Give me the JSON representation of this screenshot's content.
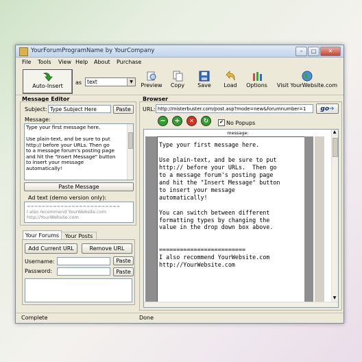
{
  "window": {
    "title": "YourForumProgramName by YourCompany",
    "controls": [
      "–",
      "□",
      "✕"
    ]
  },
  "menu": [
    "File",
    "Tools",
    "View",
    "Help",
    "About",
    "Purchase"
  ],
  "toolbar": {
    "auto_insert": "Auto-Insert",
    "as_label": "as",
    "format_value": "text",
    "preview": "Preview",
    "copy": "Copy",
    "save": "Save",
    "load": "Load",
    "options": "Options",
    "visit": "Visit YourWebsite.com"
  },
  "editor": {
    "title": "Message Editor",
    "subject_label": "Subject:",
    "subject_placeholder": "Type Subject Here",
    "paste": "Paste",
    "message_label": "Message:",
    "message_lines": [
      "Type your first message here.",
      "",
      "Use plain-text, and be sure to put",
      "http:// before your URLs.  Then go",
      "to a message forum's posting page",
      "and hit the \"Insert Message\" button",
      "to insert your message",
      "automatically!"
    ],
    "paste_message": "Paste Message",
    "ad_title": "Ad text (demo version only):",
    "ad_lines": [
      "=========================",
      "I also recommend YourWebsite.com",
      "http://YourWebsite.com"
    ]
  },
  "forums": {
    "tabs": [
      "Your Forums",
      "Your Posts"
    ],
    "add_url": "Add Current URL",
    "remove_url": "Remove URL",
    "username_label": "Username:",
    "password_label": "Password:",
    "paste": "Paste"
  },
  "browser": {
    "title": "Browser",
    "url_label": "URL:",
    "url_value": "http://misterbuster.com/post.asp?mode=new&forumnumber=1",
    "go": "go",
    "no_popups": "No Popups",
    "page_header": "message:",
    "page_lines": [
      "Type your first message here.",
      "",
      "Use plain-text, and be sure to put",
      "http:// before your URLs.  Then go",
      "to a message forum's posting page",
      "and hit the \"Insert Message\" button",
      "to insert your message",
      "automatically!",
      "",
      "You can switch between different",
      "formatting types by changing the",
      "value in the drop down box above.",
      "",
      "",
      "=========================",
      "I also recommend YourWebsite.com",
      "http://YourWebsite.com"
    ]
  },
  "status": {
    "left": "Complete",
    "right": "Done"
  }
}
